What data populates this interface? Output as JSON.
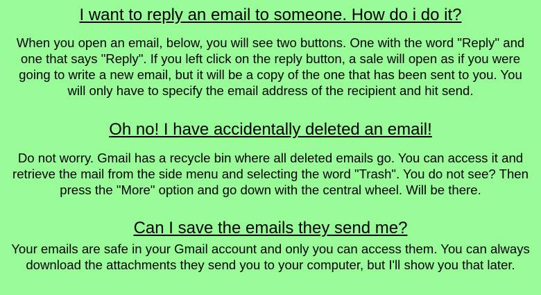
{
  "faq": [
    {
      "question": "I want to reply an email to someone. How do i do it?",
      "answer": "When you open an email, below, you will see two buttons. One with the word \"Reply\" and one that says \"Reply\". If you left click on the reply button, a sale will open as if you were going to write a new email, but it will be a copy of the one that has been sent to you. You will only have to specify the email address of the recipient and hit send."
    },
    {
      "question": "Oh no! I have accidentally deleted an email!",
      "answer": "Do not worry. Gmail has a recycle bin where all deleted emails go. You can access it and retrieve the mail from the side menu and selecting the word \"Trash\". You do not see? Then press the \"More\" option and go down with the central wheel. Will be there."
    },
    {
      "question": "Can I save the emails they send me?",
      "answer": "Your emails are safe in your Gmail account and only you can access them. You can always download the attachments they send you to your computer, but I'll show you that later."
    }
  ]
}
